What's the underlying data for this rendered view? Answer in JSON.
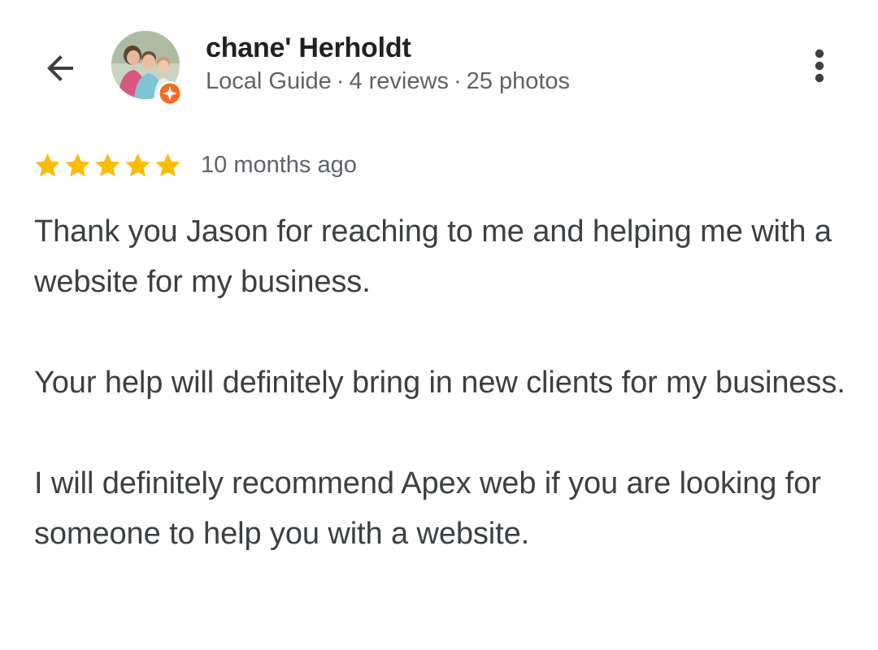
{
  "header": {
    "back_icon": "arrow-back-icon",
    "more_icon": "more-vert-icon"
  },
  "author": {
    "name": "chane' Herholdt",
    "meta": {
      "level": "Local Guide",
      "reviews": "4 reviews",
      "photos": "25 photos",
      "separator": "·"
    },
    "badge_icon": "local-guide-badge-icon",
    "badge_color": "#f36c21"
  },
  "review": {
    "rating": 5,
    "rating_max": 5,
    "star_color": "#fbbc04",
    "time_ago": "10 months ago",
    "paragraphs": [
      "Thank you Jason for reaching to me and helping me with a website for my business.",
      "Your help will definitely bring in new clients for my business.",
      "I will definitely recommend Apex web if you are looking for someone to help you with a website."
    ]
  }
}
